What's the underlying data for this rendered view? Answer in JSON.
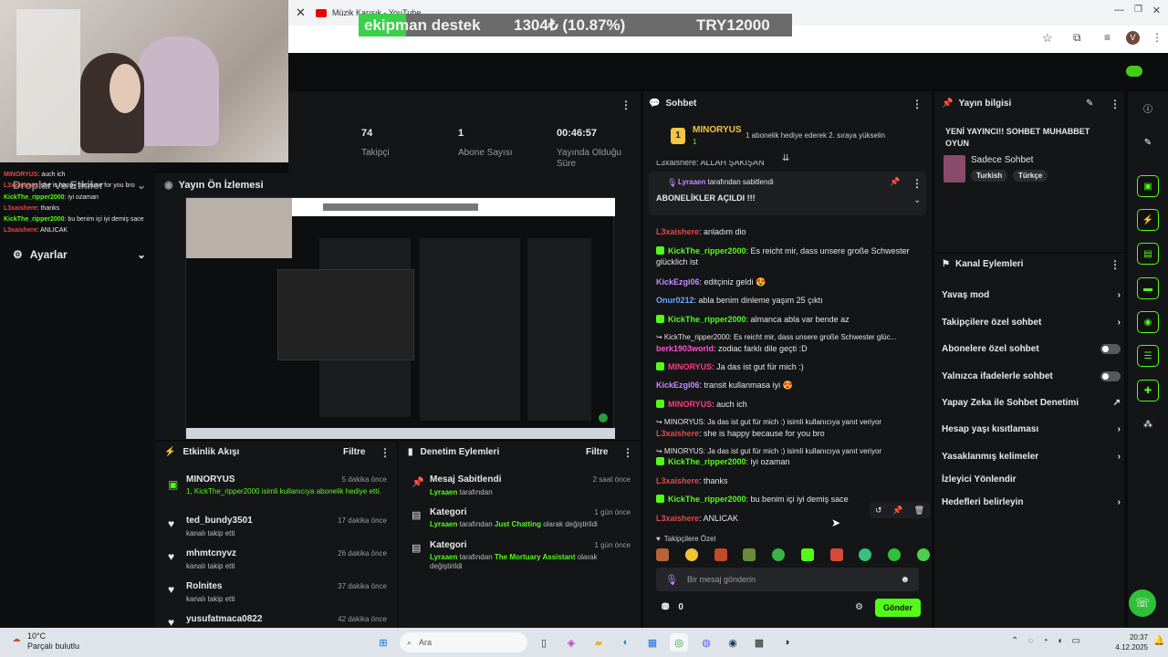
{
  "overlay": {
    "text": "ekipman destek",
    "highlight": "ekip",
    "amount": "1304₺ (10.87%)",
    "goal": "TRY12000"
  },
  "browser": {
    "tab1": "Müzik Karışık - YouTube",
    "avatar_letter": "V"
  },
  "stats": {
    "followers_value": "74",
    "followers_label": "Takipçi",
    "subs_value": "1",
    "subs_label": "Abone Sayısı",
    "uptime_value": "00:46:57",
    "uptime_label": "Yayında Olduğu Süre"
  },
  "preview": {
    "title": "Yayın Ön İzlemesi"
  },
  "left_panel": {
    "overlay_chat": [
      {
        "user": "MINORYUS",
        "text": ": auch ich"
      },
      {
        "user": "L3xaishere",
        "text": ": she is happy because for you bro"
      },
      {
        "user": "KickThe_ripper2000",
        "text": ": iyi ozaman"
      },
      {
        "user": "L3xaishere",
        "text": ": thanks"
      },
      {
        "user": "KickThe_ripper2000",
        "text": ": bu benim içi iyi demiş sace"
      },
      {
        "user": "L3xaishere",
        "text": ": ANLICAK"
      }
    ],
    "drops": "Droplar ve Etkiler",
    "settings": "Ayarlar"
  },
  "activity": {
    "title": "Etkinlik Akışı",
    "filter": "Filtre",
    "items": [
      {
        "name": "MINORYUS",
        "time": "5 dakika önce",
        "detail": "1, KickThe_ripper2000 isimli kullanıcıya abonelik hediye etti."
      },
      {
        "name": "ted_bundy3501",
        "time": "17 dakika önce",
        "detail": "kanalı takip etti"
      },
      {
        "name": "mhmtcnyvz",
        "time": "26 dakika önce",
        "detail": "kanalı takip etti"
      },
      {
        "name": "Rolnites",
        "time": "37 dakika önce",
        "detail": "kanalı takip etti"
      },
      {
        "name": "yusufatmaca0822",
        "time": "42 dakika önce",
        "detail": ""
      }
    ]
  },
  "modlog": {
    "title": "Denetim Eylemleri",
    "filter": "Filtre",
    "items": [
      {
        "name": "Mesaj Sabitlendi",
        "time": "2 saat önce",
        "user": "Lyraaen",
        "detail": " tarafından"
      },
      {
        "name": "Kategori",
        "time": "1 gün önce",
        "user": "Lyraaen",
        "detail": " tarafından ",
        "cat": "Just Chatting",
        "tail": " olarak değiştirildi"
      },
      {
        "name": "Kategori",
        "time": "1 gün önce",
        "user": "Lyraaen",
        "detail": " tarafından ",
        "cat": "The Mortuary Assistant",
        "tail": " olarak değiştirildi"
      }
    ]
  },
  "chat": {
    "title": "Sohbet",
    "top_gifter": "MINORYUS",
    "top_gifter_count": "1",
    "gift_text": "1 abonelik hediye ederek 2. sıraya yükselin",
    "pinned_by": "Lyraaen",
    "pinned_suffix": " tarafından sabitlendi",
    "pinned_text": "ABONELİKLER AÇILDI !!!",
    "partial_top": "L3xaishere: ALLAH ŞAKIŞAN",
    "messages": [
      {
        "user": "L3xaishere",
        "text": ": anladım dio",
        "color": "red"
      },
      {
        "user": "KickThe_ripper2000",
        "text": ": Es reicht mir, dass unsere große Schwester glücklich ist",
        "color": "green"
      },
      {
        "user": "KickEzgi06",
        "text": ": editçiniz geldi 😍",
        "color": "purple"
      },
      {
        "user": "Onur0212",
        "text": ": abla benim dinleme yaşım 25 çıktı",
        "color": "blue"
      },
      {
        "user": "KickThe_ripper2000",
        "text": ": almanca abla var bende az",
        "color": "green"
      },
      {
        "user": "berk1903world",
        "text": ": zodiac farklı dile geçti :D",
        "color": "pink",
        "reply": "↪ KickThe_ripper2000: Es reicht mir, dass unsere große Schwester glüc..."
      },
      {
        "user": "MINORYUS",
        "text": ": Ja das ist gut für mich :)",
        "color": "pinkred"
      },
      {
        "user": "KickEzgi06",
        "text": ": transit kullanmasa iyi 😍",
        "color": "purple"
      },
      {
        "user": "MINORYUS",
        "text": ": auch ich",
        "color": "pinkred"
      },
      {
        "user": "L3xaishere",
        "text": ": she is happy because for you bro",
        "color": "red",
        "reply": "↪ MINORYUS: Ja das ist gut für mich :) isimli kullanıcıya yanıt veriyor"
      },
      {
        "user": "KickThe_ripper2000",
        "text": ": iyi ozaman",
        "color": "green",
        "reply": "↪ MINORYUS: Ja das ist gut für mich :) isimli kullanıcıya yanıt veriyor"
      },
      {
        "user": "L3xaishere",
        "text": ": thanks",
        "color": "red"
      },
      {
        "user": "KickThe_ripper2000",
        "text": ": bu benim içi iyi demiş sace",
        "color": "green"
      },
      {
        "user": "L3xaishere",
        "text": ": ANLICAK",
        "color": "red"
      }
    ],
    "followers_only": "Takipçilere Özel",
    "input_placeholder": "Bir mesaj gönderin",
    "points": "0",
    "send": "Gönder"
  },
  "info": {
    "title": "Yayın bilgisi",
    "stream_title": "YENİ YAYINCI!! SOHBET MUHABBET OYUN",
    "category": "Sadece Sohbet",
    "tags": [
      "Turkish",
      "Türkçe"
    ],
    "actions_title": "Kanal Eylemleri",
    "actions": [
      {
        "label": "Yavaş mod",
        "ctl": "chevron"
      },
      {
        "label": "Takipçilere özel sohbet",
        "ctl": "chevron"
      },
      {
        "label": "Abonelere özel sohbet",
        "ctl": "toggle"
      },
      {
        "label": "Yalnızca ifadelerle sohbet",
        "ctl": "toggle"
      },
      {
        "label": "Yapay Zeka ile Sohbet Denetimi",
        "ctl": "external"
      },
      {
        "label": "Hesap yaşı kısıtlaması",
        "ctl": "chevron"
      },
      {
        "label": "Yasaklanmış kelimeler",
        "ctl": "chevron"
      },
      {
        "label": "İzleyici Yönlendir",
        "ctl": "none"
      },
      {
        "label": "Hedefleri belirleyin",
        "ctl": "chevron"
      }
    ]
  },
  "taskbar": {
    "temp": "10°C",
    "weather": "Parçalı bulutlu",
    "search": "Ara",
    "time": "20:37",
    "date": "4.12.2025"
  },
  "colors": {
    "kick_green": "#53fc18",
    "panel": "#141517",
    "bg": "#0b0c0d"
  }
}
